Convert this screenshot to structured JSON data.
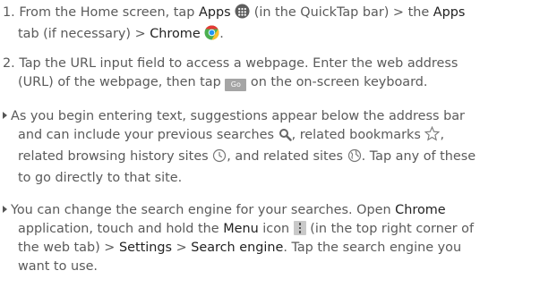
{
  "step1": {
    "number": "1.",
    "t1": "From the Home screen, tap",
    "apps": "Apps",
    "t2": "(in the QuickTap bar) >",
    "the": "the",
    "apps_tab": "Apps",
    "t3": "tab (if necessary) >",
    "chrome": "Chrome",
    "t4": "."
  },
  "step2": {
    "number": "2.",
    "line1": "Tap the URL input field to access a webpage. Enter the web address",
    "t1": "(URL) of the webpage, then tap",
    "go_key": "Go",
    "t2": "on the on-screen keyboard."
  },
  "bullet1": {
    "line1": "As you begin entering text, suggestions appear below the address bar",
    "l2a": "and can include your previous searches",
    "l2b": ", related bookmarks",
    "l2c": ",",
    "l3a": "related browsing history sites",
    "l3b": ", and related sites",
    "l3c": ". Tap any of these",
    "line4": "to go directly to that site."
  },
  "bullet2": {
    "l1a": "You can change the search engine for your searches. Open",
    "chrome": "Chrome",
    "l2a": "application, touch and hold the",
    "menu": "Menu",
    "l2b": "icon",
    "l2c": "(in the top right corner of",
    "l3a": "the web tab) >",
    "settings": "Settings",
    "gt": ">",
    "search_engine": "Search engine",
    "l3b": ". Tap the search engine you",
    "line4": "want to use."
  },
  "colors": {
    "body_text": "#5a5a5a",
    "bold_text": "#222222",
    "go_key_bg": "#a5a5a5",
    "menu_key_bg": "#c9c9c9"
  },
  "icons": [
    "apps-grid-icon",
    "chrome-logo-icon",
    "search-icon",
    "star-outline-icon",
    "clock-icon",
    "globe-icon",
    "menu-dots-icon"
  ]
}
